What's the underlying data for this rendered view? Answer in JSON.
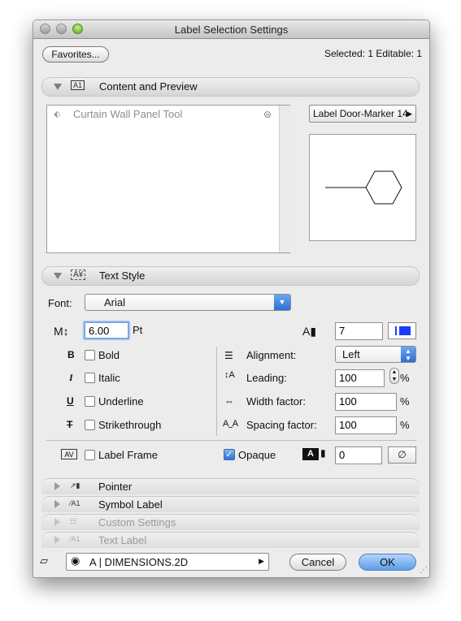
{
  "window": {
    "title": "Label Selection Settings"
  },
  "header": {
    "favorites_label": "Favorites...",
    "selection_info": "Selected: 1 Editable: 1"
  },
  "content_preview": {
    "title": "Content and Preview",
    "list_item": "Curtain Wall Panel Tool",
    "label_type": "Label Door-Marker 14"
  },
  "text_style": {
    "title": "Text Style",
    "font_label": "Font:",
    "font_value": "Arial",
    "size_value": "6.00",
    "size_unit": "Pt",
    "pen_value": "7",
    "bold_label": "Bold",
    "italic_label": "Italic",
    "underline_label": "Underline",
    "strike_label": "Strikethrough",
    "alignment_label": "Alignment:",
    "alignment_value": "Left",
    "leading_label": "Leading:",
    "leading_value": "100",
    "width_label": "Width factor:",
    "width_value": "100",
    "spacing_label": "Spacing factor:",
    "spacing_value": "100",
    "percent": "%",
    "label_frame": "Label Frame",
    "opaque_label": "Opaque",
    "opaque_pen_value": "0",
    "opaque_checked": true
  },
  "sections": {
    "pointer": "Pointer",
    "symbol_label": "Symbol Label",
    "custom_settings": "Custom Settings",
    "text_label": "Text Label"
  },
  "footer": {
    "layer": "A | DIMENSIONS.2D",
    "cancel": "Cancel",
    "ok": "OK"
  },
  "colors": {
    "accent": "#3b7fd9",
    "ok_button": "#7fb2ee",
    "pen_color": "#1a3cff"
  }
}
